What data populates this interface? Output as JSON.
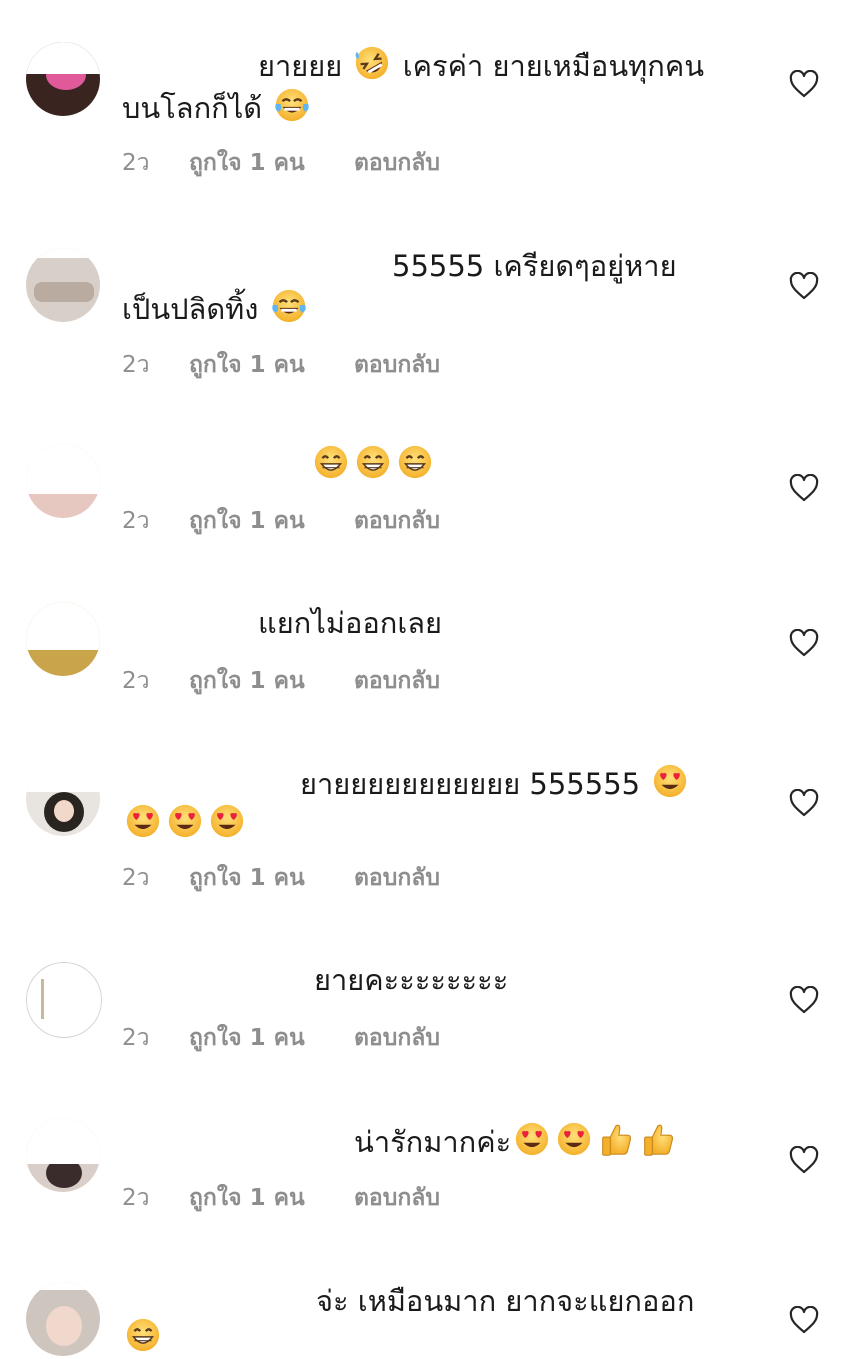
{
  "comments": [
    {
      "line1": "ยายยย",
      "line1b": "เครค่า ยายเหมือนทุกคน",
      "line2": "บนโลกก็ได้",
      "time": "2ว",
      "likes": "ถูกใจ 1 คน",
      "reply": "ตอบกลับ"
    },
    {
      "line1": "55555 เครียดๆอยู่หาย",
      "line2": "เป็นปลิดทิ้ง",
      "time": "2ว",
      "likes": "ถูกใจ 1 คน",
      "reply": "ตอบกลับ"
    },
    {
      "line1": "",
      "time": "2ว",
      "likes": "ถูกใจ 1 คน",
      "reply": "ตอบกลับ"
    },
    {
      "line1": "แยกไม่ออกเลย",
      "time": "2ว",
      "likes": "ถูกใจ 1 คน",
      "reply": "ตอบกลับ"
    },
    {
      "line1": "ยายยยยยยยยยยย 555555",
      "time": "2ว",
      "likes": "ถูกใจ 1 คน",
      "reply": "ตอบกลับ"
    },
    {
      "line1": "ยายคะะะะะะะะ",
      "time": "2ว",
      "likes": "ถูกใจ 1 คน",
      "reply": "ตอบกลับ"
    },
    {
      "line1": "น่ารักมากค่ะ",
      "time": "2ว",
      "likes": "ถูกใจ 1 คน",
      "reply": "ตอบกลับ"
    },
    {
      "line1": "จ่ะ เหมือนมาก ยากจะแยกออก",
      "time": "",
      "likes": "",
      "reply": ""
    }
  ],
  "icons": {
    "heart": "heart-outline-icon",
    "laugh": "rolling-on-floor-laughing-emoji",
    "tears": "face-with-tears-of-joy-emoji",
    "grin": "beaming-face-emoji",
    "heart_eyes": "heart-eyes-emoji",
    "thumbs_up": "thumbs-up-emoji"
  },
  "colors": {
    "meta": "#8e8e8e",
    "text": "#1a1a1a",
    "emoji": "#f8c63d"
  }
}
